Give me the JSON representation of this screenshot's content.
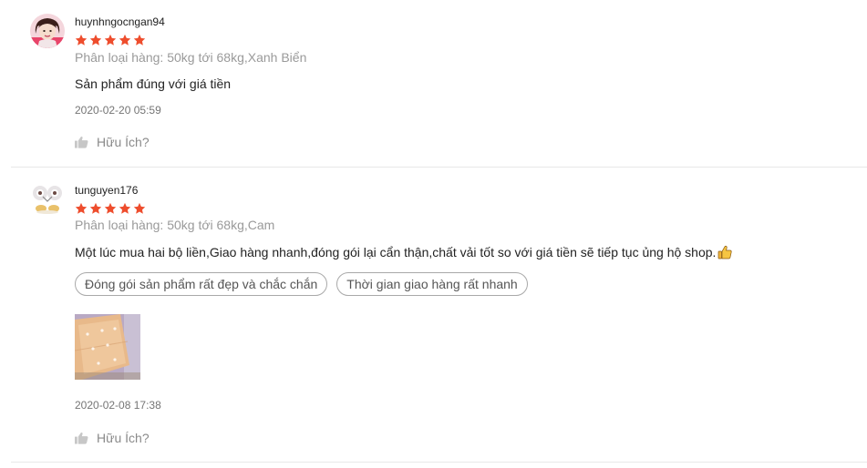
{
  "reviews": [
    {
      "username": "huynhngocngan94",
      "rating": 5,
      "variation": "Phân loại hàng: 50kg tới 68kg,Xanh Biển",
      "comment": "Sản phẩm đúng với giá tiền",
      "timestamp": "2020-02-20 05:59",
      "helpful_label": "Hữu Ích?"
    },
    {
      "username": "tunguyen176",
      "rating": 5,
      "variation": "Phân loại hàng: 50kg tới 68kg,Cam",
      "comment": "Một lúc mua hai bộ liền,Giao hàng nhanh,đóng gói lại cẩn thận,chất vải tốt so với giá tiền sẽ tiếp tục ủng hộ shop.",
      "comment_emoji": "thumbs-up-emoji",
      "tags": [
        "Đóng gói sản phẩm rất đẹp và chắc chắn",
        "Thời gian giao hàng rất nhanh"
      ],
      "timestamp": "2020-02-08 17:38",
      "helpful_label": "Hữu Ích?"
    }
  ],
  "colors": {
    "star": "#ee4d2d",
    "muted_text": "#9a9a9a",
    "tag_border": "#a9a9a9",
    "divider": "#e8e8e8"
  },
  "icons": {
    "star": "star-icon",
    "helpful": "thumbs-up-icon"
  }
}
